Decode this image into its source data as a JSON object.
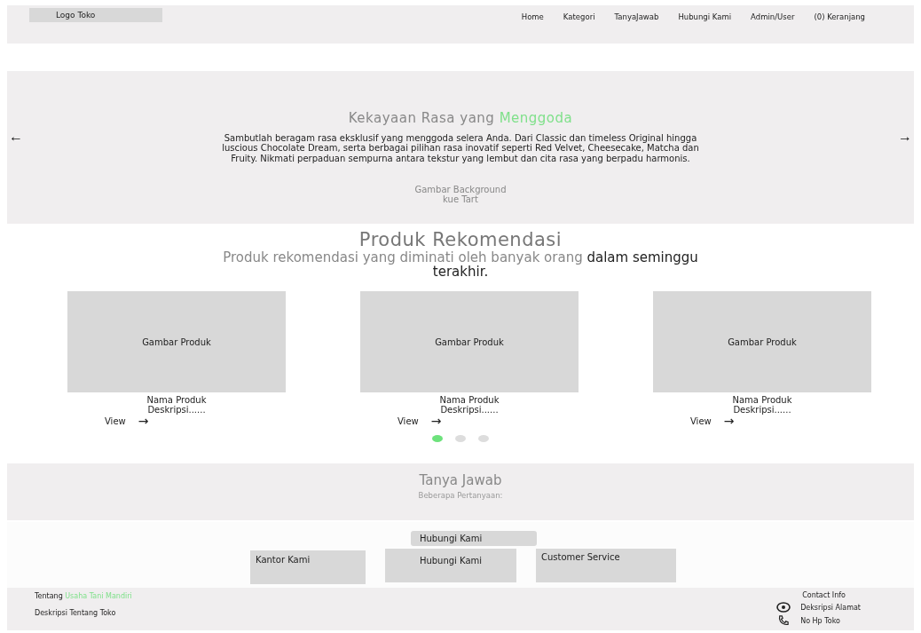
{
  "header": {
    "logo": "Logo Toko",
    "nav": [
      {
        "label": "Home"
      },
      {
        "label": "Kategori"
      },
      {
        "label": "TanyaJawab"
      },
      {
        "label": "Hubungi Kami"
      },
      {
        "label": "Admin/User"
      },
      {
        "label": "(0) Keranjang"
      }
    ]
  },
  "hero": {
    "prev": "←",
    "next": "→",
    "title": "Kekayaan Rasa yang",
    "title_highlight": "Menggoda",
    "text": "Sambutlah beragam rasa eksklusif yang menggoda selera Anda. Dari Classic dan timeless Original hingga luscious Chocolate Dream, serta berbagai pilihan rasa inovatif seperti Red Velvet, Cheesecake, Matcha dan Fruity. Nikmati perpaduan sempurna antara tekstur yang lembut dan cita rasa yang berpadu harmonis.",
    "background_note": [
      "Gambar Background",
      "kue Tart"
    ]
  },
  "recommendations": {
    "title": "Produk Rekomendasi",
    "subtitle": "Produk rekomendasi yang diminati oleh banyak orang **dalam seminggu terakhir.**",
    "products": [
      {
        "image": "Gambar Produk",
        "name": "Nama Produk",
        "description": "Deskripsi......",
        "link": "View",
        "arrow": "→"
      },
      {
        "image": "Gambar Produk",
        "name": "Nama Produk",
        "description": "Deskripsi......",
        "link": "View",
        "arrow": "→"
      },
      {
        "image": "Gambar Produk",
        "name": "Nama Produk",
        "description": "Deskripsi......",
        "link": "View",
        "arrow": "→"
      }
    ],
    "dots": [
      {
        "selected": true
      },
      {
        "selected": false
      },
      {
        "selected": false
      }
    ]
  },
  "faq": {
    "title": "Tanya Jawab",
    "subtitle": "Beberapa Pertanyaan:"
  },
  "contact": {
    "heading": "Hubungi Kami",
    "cards": [
      "Kantor Kami",
      "Hubungi Kami",
      "Customer Service"
    ]
  },
  "footer": {
    "about": "Tentang",
    "brand": "Usaha Tani Mandiri",
    "description": "Deskripsi Tentang Toko",
    "contact_title": "Contact Info",
    "address": "Deksripsi Alamat",
    "phone": "No Hp Toko"
  }
}
